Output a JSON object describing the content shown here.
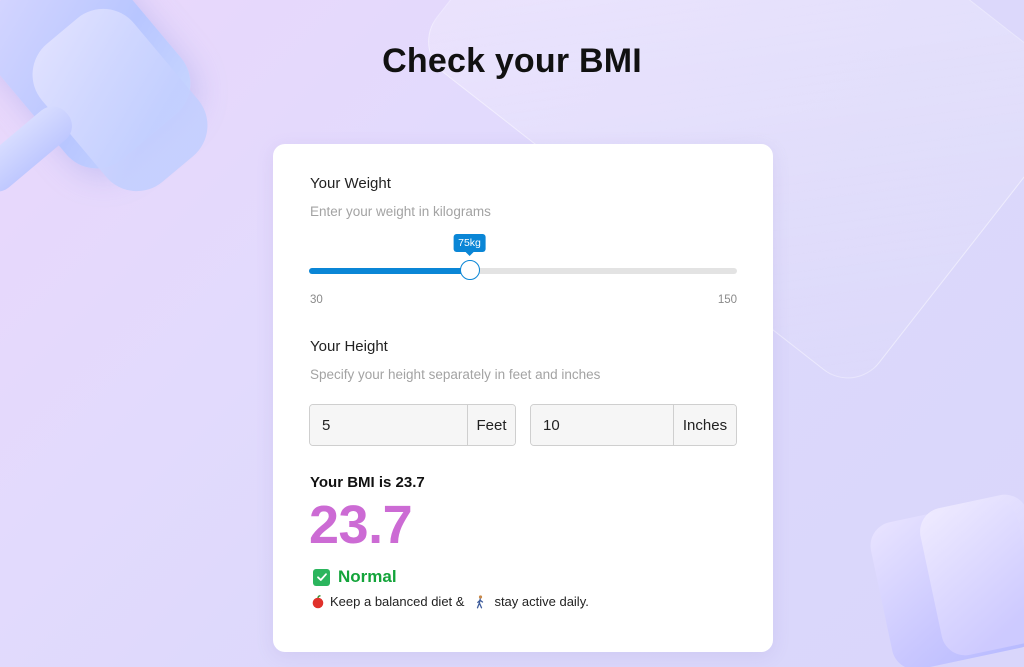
{
  "page": {
    "title": "Check your BMI"
  },
  "weight": {
    "title": "Your Weight",
    "subtitle": "Enter your weight in kilograms",
    "slider": {
      "min": 30,
      "max": 150,
      "value": 75,
      "min_label": "30",
      "max_label": "150",
      "tooltip": "75kg"
    }
  },
  "height": {
    "title": "Your Height",
    "subtitle": "Specify your height separately in feet and inches",
    "feet": {
      "value": "5",
      "unit": "Feet"
    },
    "inches": {
      "value": "10",
      "unit": "Inches"
    }
  },
  "result": {
    "label": "Your BMI is 23.7",
    "value": "23.7",
    "status": "Normal",
    "tip_part1": "Keep a balanced diet &",
    "tip_part2": "stay active daily.",
    "icons": {
      "status": "check-mark-icon",
      "tip_1": "apple-icon",
      "tip_2": "walking-person-icon"
    }
  },
  "colors": {
    "accent": "#0a86d6",
    "bmi_value": "#cc6bd4",
    "status_green": "#13a43a",
    "check_bg": "#2bb55d"
  }
}
